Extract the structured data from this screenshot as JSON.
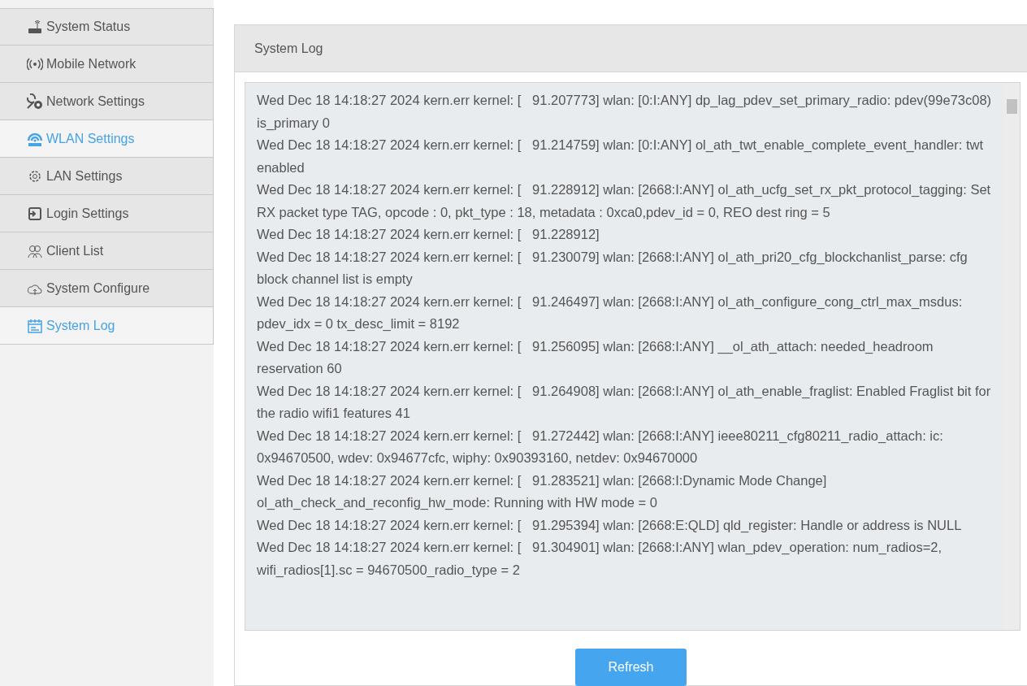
{
  "sidebar": {
    "items": [
      {
        "label": "System Status",
        "selected": false
      },
      {
        "label": "Mobile Network",
        "selected": false
      },
      {
        "label": "Network Settings",
        "selected": false
      },
      {
        "label": "WLAN Settings",
        "selected": true
      },
      {
        "label": "LAN Settings",
        "selected": false
      },
      {
        "label": "Login Settings",
        "selected": false
      },
      {
        "label": "Client List",
        "selected": false
      },
      {
        "label": "System Configure",
        "selected": false
      },
      {
        "label": "System Log",
        "selected": true
      }
    ]
  },
  "panel": {
    "title": "System Log",
    "log_lines": [
      "Wed Dec 18 14:18:27 2024 kern.err kernel: [   91.207773] wlan: [0:I:ANY] dp_lag_pdev_set_primary_radio: pdev(99e73c08) is_primary 0",
      "Wed Dec 18 14:18:27 2024 kern.err kernel: [   91.214759] wlan: [0:I:ANY] ol_ath_twt_enable_complete_event_handler: twt enabled",
      "Wed Dec 18 14:18:27 2024 kern.err kernel: [   91.228912] wlan: [2668:I:ANY] ol_ath_ucfg_set_rx_pkt_protocol_tagging: Set RX packet type TAG, opcode : 0, pkt_type : 18, metadata : 0xca0,pdev_id = 0, REO dest ring = 5",
      "Wed Dec 18 14:18:27 2024 kern.err kernel: [   91.228912]",
      "Wed Dec 18 14:18:27 2024 kern.err kernel: [   91.230079] wlan: [2668:I:ANY] ol_ath_pri20_cfg_blockchanlist_parse: cfg block channel list is empty",
      "Wed Dec 18 14:18:27 2024 kern.err kernel: [   91.246497] wlan: [2668:I:ANY] ol_ath_configure_cong_ctrl_max_msdus: pdev_idx = 0 tx_desc_limit = 8192",
      "Wed Dec 18 14:18:27 2024 kern.err kernel: [   91.256095] wlan: [2668:I:ANY] __ol_ath_attach: needed_headroom reservation 60",
      "Wed Dec 18 14:18:27 2024 kern.err kernel: [   91.264908] wlan: [2668:I:ANY] ol_ath_enable_fraglist: Enabled Fraglist bit for the radio wifi1 features 41",
      "Wed Dec 18 14:18:27 2024 kern.err kernel: [   91.272442] wlan: [2668:I:ANY] ieee80211_cfg80211_radio_attach: ic: 0x94670500, wdev: 0x94677cfc, wiphy: 0x90393160, netdev: 0x94670000",
      "Wed Dec 18 14:18:27 2024 kern.err kernel: [   91.283521] wlan: [2668:I:Dynamic Mode Change] ol_ath_check_and_reconfig_hw_mode: Running with HW mode = 0",
      "Wed Dec 18 14:18:27 2024 kern.err kernel: [   91.295394] wlan: [2668:E:QLD] qld_register: Handle or address is NULL",
      "Wed Dec 18 14:18:27 2024 kern.err kernel: [   91.304901] wlan: [2668:I:ANY] wlan_pdev_operation: num_radios=2, wifi_radios[1].sc = 94670500_radio_type = 2"
    ],
    "refresh_button": "Refresh"
  }
}
